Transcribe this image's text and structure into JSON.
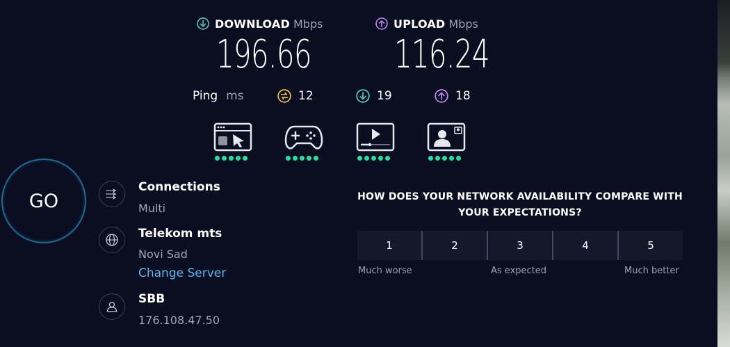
{
  "download": {
    "label": "DOWNLOAD",
    "unit": "Mbps",
    "value": "196.66",
    "icon": "arrow-down-circle-icon",
    "color": "#4fd1c5"
  },
  "upload": {
    "label": "UPLOAD",
    "unit": "Mbps",
    "value": "116.24",
    "icon": "arrow-up-circle-icon",
    "color": "#c58af9"
  },
  "ping": {
    "label": "Ping",
    "unit": "ms",
    "idle": "12",
    "download": "19",
    "upload": "18",
    "idle_color": "#f0c24b"
  },
  "activities": [
    {
      "name": "web-browsing-icon",
      "quality": 5
    },
    {
      "name": "gaming-icon",
      "quality": 5
    },
    {
      "name": "video-streaming-icon",
      "quality": 5
    },
    {
      "name": "video-chat-icon",
      "quality": 5
    }
  ],
  "go_label": "GO",
  "connections": {
    "title": "Connections",
    "value": "Multi"
  },
  "server": {
    "title": "Telekom mts",
    "location": "Novi Sad",
    "change_label": "Change Server"
  },
  "provider": {
    "title": "SBB",
    "ip": "176.108.47.50"
  },
  "survey": {
    "question_line1": "HOW DOES YOUR NETWORK AVAILABILITY COMPARE WITH",
    "question_line2": "YOUR EXPECTATIONS?",
    "options": [
      "1",
      "2",
      "3",
      "4",
      "5"
    ],
    "low_label": "Much worse",
    "mid_label": "As expected",
    "high_label": "Much better"
  }
}
